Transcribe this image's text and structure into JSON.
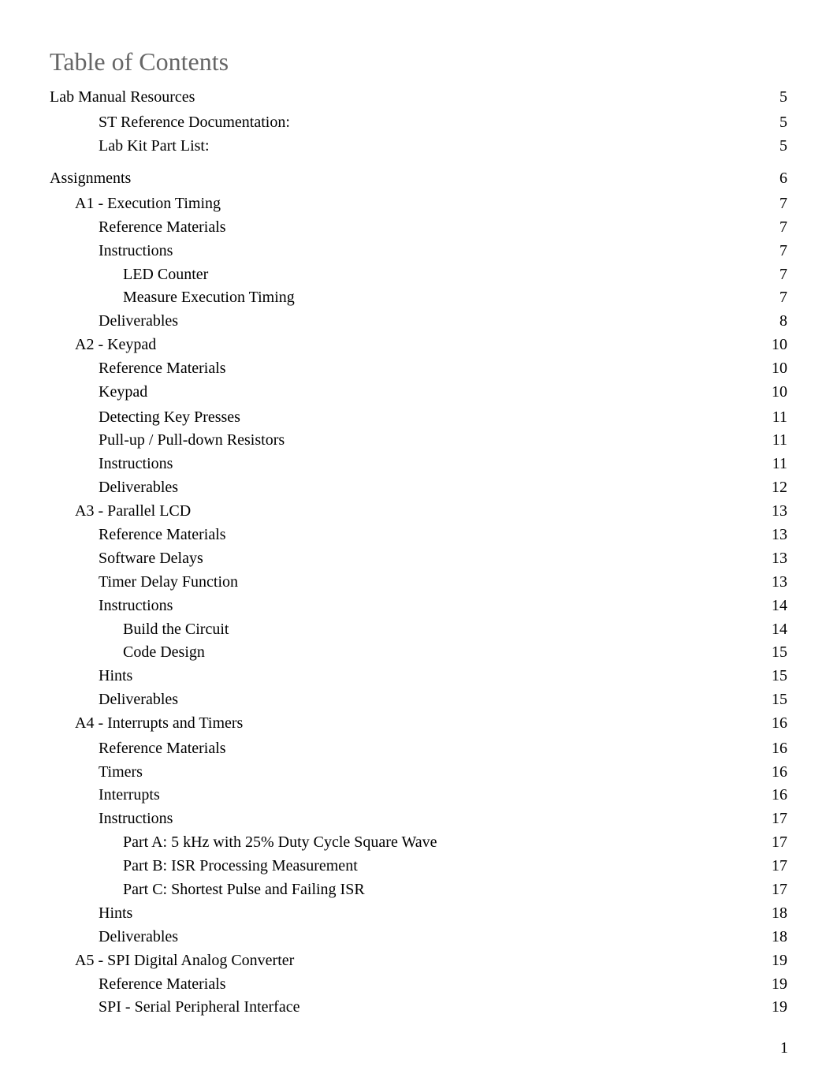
{
  "document": {
    "title": "Table of Contents",
    "page_number": "1",
    "entries": [
      {
        "label": "Lab Manual Resources",
        "page": "5",
        "level": 0
      },
      {
        "label": "ST Reference Documentation:",
        "page": "5",
        "level": 2
      },
      {
        "label": "Lab Kit Part List:",
        "page": "5",
        "level": 2
      },
      {
        "label": "Assignments",
        "page": "6",
        "level": 0
      },
      {
        "label": "A1 - Execution Timing",
        "page": "7",
        "level": 1
      },
      {
        "label": "Reference Materials",
        "page": "7",
        "level": 2
      },
      {
        "label": "Instructions",
        "page": "7",
        "level": 2
      },
      {
        "label": "LED Counter",
        "page": "7",
        "level": 3
      },
      {
        "label": "Measure Execution Timing",
        "page": "7",
        "level": 3
      },
      {
        "label": "Deliverables",
        "page": "8",
        "level": 2
      },
      {
        "label": "A2 - Keypad",
        "page": "10",
        "level": 1
      },
      {
        "label": "Reference Materials",
        "page": "10",
        "level": 2
      },
      {
        "label": "Keypad",
        "page": "10",
        "level": 2
      },
      {
        "label": "Detecting Key Presses",
        "page": "11",
        "level": 2
      },
      {
        "label": "Pull-up / Pull-down Resistors",
        "page": "11",
        "level": 2
      },
      {
        "label": "Instructions",
        "page": "11",
        "level": 2
      },
      {
        "label": "Deliverables",
        "page": "12",
        "level": 2
      },
      {
        "label": "A3 - Parallel LCD",
        "page": "13",
        "level": 1
      },
      {
        "label": "Reference Materials",
        "page": "13",
        "level": 2
      },
      {
        "label": "Software Delays",
        "page": "13",
        "level": 2
      },
      {
        "label": "Timer Delay Function",
        "page": "13",
        "level": 2
      },
      {
        "label": "Instructions",
        "page": "14",
        "level": 2
      },
      {
        "label": "Build the Circuit",
        "page": "14",
        "level": 3
      },
      {
        "label": "Code Design",
        "page": "15",
        "level": 3
      },
      {
        "label": "Hints",
        "page": "15",
        "level": 2
      },
      {
        "label": "Deliverables",
        "page": "15",
        "level": 2
      },
      {
        "label": "A4 - Interrupts and Timers",
        "page": "16",
        "level": 1
      },
      {
        "label": "Reference Materials",
        "page": "16",
        "level": 2
      },
      {
        "label": "Timers",
        "page": "16",
        "level": 2
      },
      {
        "label": "Interrupts",
        "page": "16",
        "level": 2
      },
      {
        "label": "Instructions",
        "page": "17",
        "level": 2
      },
      {
        "label": "Part A: 5 kHz with 25% Duty Cycle Square Wave",
        "page": "17",
        "level": 3
      },
      {
        "label": "Part B: ISR Processing Measurement",
        "page": "17",
        "level": 3
      },
      {
        "label": "Part C: Shortest Pulse and Failing ISR",
        "page": "17",
        "level": 3
      },
      {
        "label": "Hints",
        "page": "18",
        "level": 2
      },
      {
        "label": "Deliverables",
        "page": "18",
        "level": 2
      },
      {
        "label": "A5 - SPI Digital Analog Converter",
        "page": "19",
        "level": 1
      },
      {
        "label": "Reference Materials",
        "page": "19",
        "level": 2
      },
      {
        "label": "SPI - Serial Peripheral Interface",
        "page": "19",
        "level": 2
      }
    ]
  }
}
